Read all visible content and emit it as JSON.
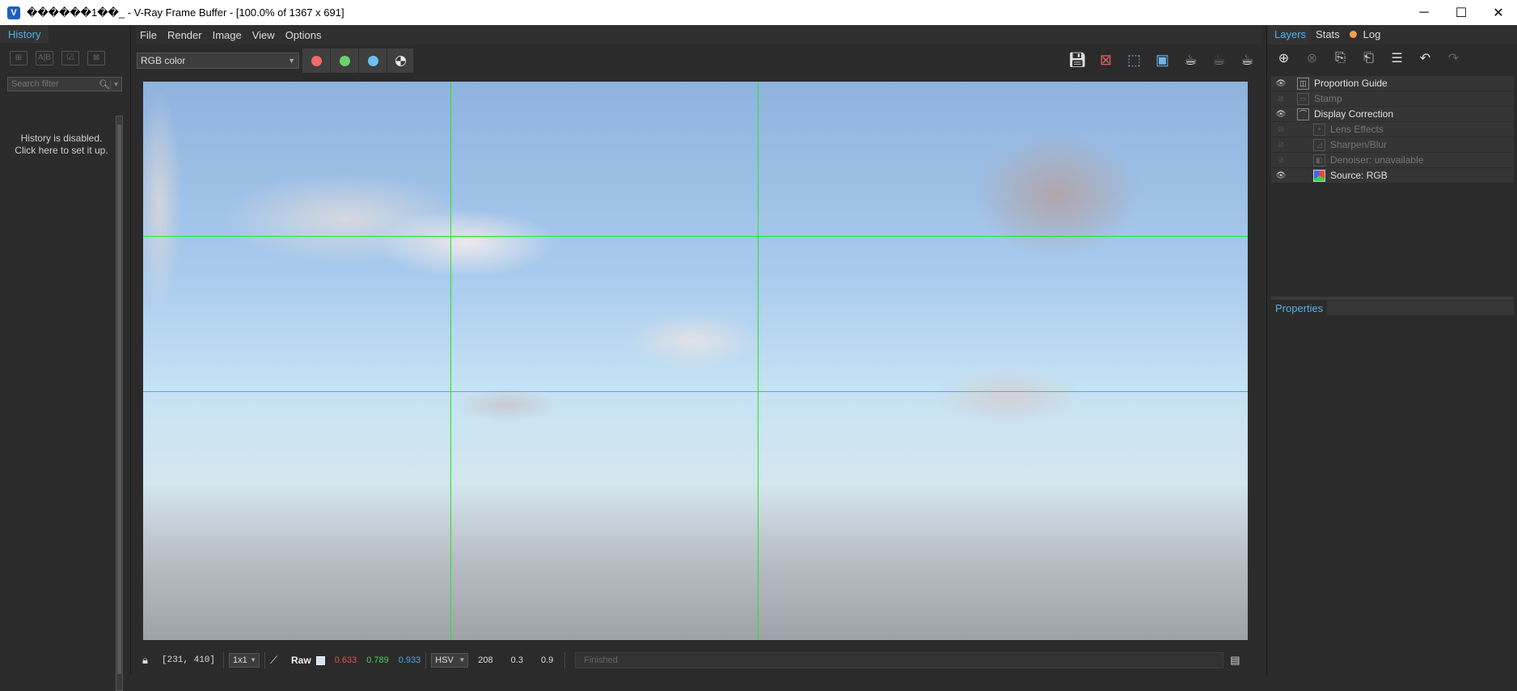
{
  "window": {
    "title": "������1��_ - V-Ray Frame Buffer - [100.0% of 1367 x 691]",
    "minimize": "─",
    "maximize": "☐",
    "close": "✕"
  },
  "history": {
    "tab": "History",
    "search_placeholder": "Search filter",
    "message_line1": "History is disabled.",
    "message_line2": "Click here to set it up."
  },
  "menu": [
    "File",
    "Render",
    "Image",
    "View",
    "Options"
  ],
  "toolbar": {
    "channel": "RGB color",
    "channel_colors": {
      "red": "#f06a6a",
      "green": "#6ad36a",
      "blue": "#6ec0f0"
    }
  },
  "status": {
    "coords": "[231, 410]",
    "ratio": "1x1",
    "raw_label": "Raw",
    "r": "0.633",
    "g": "0.789",
    "b": "0.933",
    "color_mode": "HSV",
    "h": "208",
    "s": "0.3",
    "v": "0.9",
    "message": "Finished",
    "value_colors": {
      "r": "#e85050",
      "g": "#50d050",
      "b": "#50a8e8"
    }
  },
  "right_panel": {
    "tabs": [
      "Layers",
      "Stats",
      "Log"
    ],
    "layers": [
      {
        "name": "Proportion Guide",
        "enabled": true,
        "indent": false,
        "icon": "guide-icon"
      },
      {
        "name": "Stamp",
        "enabled": false,
        "indent": false,
        "icon": "stamp-icon"
      },
      {
        "name": "Display Correction",
        "enabled": true,
        "indent": false,
        "icon": "curve-icon"
      },
      {
        "name": "Lens Effects",
        "enabled": false,
        "indent": true,
        "icon": "plus-icon"
      },
      {
        "name": "Sharpen/Blur",
        "enabled": false,
        "indent": true,
        "icon": "sharpen-icon"
      },
      {
        "name": "Denoiser: unavailable",
        "enabled": false,
        "indent": true,
        "icon": "denoise-icon"
      },
      {
        "name": "Source: RGB",
        "enabled": true,
        "indent": true,
        "icon": "rgb-icon"
      }
    ],
    "properties_label": "Properties"
  }
}
